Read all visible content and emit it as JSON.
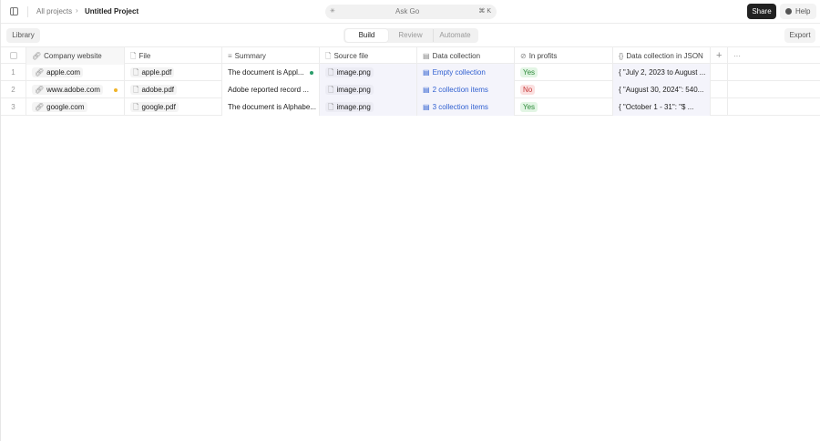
{
  "topbar": {
    "breadcrumb_root": "All projects",
    "project_title": "Untitled Project",
    "ask_placeholder": "Ask Go",
    "ask_shortcut": "⌘ K",
    "share": "Share",
    "help": "Help"
  },
  "toolbar": {
    "library": "Library",
    "tabs": [
      "Build",
      "Review",
      "Automate"
    ],
    "active_tab": "Build",
    "export": "Export"
  },
  "table": {
    "columns": [
      "Company website",
      "File",
      "Summary",
      "Source file",
      "Data collection",
      "In profits",
      "Data collection in JSON"
    ],
    "rows": [
      {
        "num": "1",
        "website": "apple.com",
        "file": "apple.pdf",
        "summary": "The document is Appl...",
        "source": "image.png",
        "collection": "Empty collection",
        "profits": "Yes",
        "json": "{  \"July 2, 2023 to August ..."
      },
      {
        "num": "2",
        "website": "www.adobe.com",
        "file": "adobe.pdf",
        "summary": "Adobe reported record ...",
        "source": "image.png",
        "collection": "2 collection items",
        "profits": "No",
        "json": "{  \"August 30, 2024\": 540..."
      },
      {
        "num": "3",
        "website": "google.com",
        "file": "google.pdf",
        "summary": "The document is Alphabe...",
        "source": "image.png",
        "collection": "3 collection items",
        "profits": "Yes",
        "json": "{  \"October 1 - 31\": \"$ ..."
      }
    ]
  },
  "colors": {
    "yes": "#2e8a3a",
    "no": "#c73a3a",
    "link": "#2f5fd0",
    "status_green": "#2a9d6a",
    "status_yellow": "#f0b429"
  }
}
